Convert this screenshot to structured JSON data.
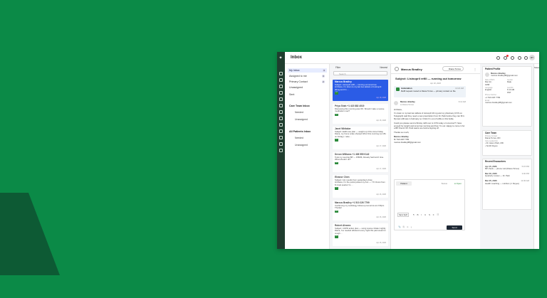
{
  "app": {
    "title": "Inbox",
    "avatar": "RT",
    "notif_count": "8"
  },
  "nav": {
    "items": [
      {
        "label": "My Inbox",
        "count": "3"
      },
      {
        "label": "Assigned to me",
        "count": "3"
      },
      {
        "label": "Primary Contact",
        "count": "2"
      },
      {
        "label": "Unassigned"
      },
      {
        "label": "Sent"
      }
    ],
    "care_team": {
      "title": "Care Team Inbox",
      "items": [
        "Needed",
        "Unassigned"
      ]
    },
    "all": {
      "title": "All Patients Inbox",
      "items": [
        "Needed",
        "Unassigned"
      ]
    }
  },
  "list": {
    "filter": "Filter",
    "sort": "Newest",
    "search_placeholder": "Search",
    "cards": [
      {
        "name": "Marcus Bradley",
        "line1": "Subject: Lisinopril refill — running out tomorrow",
        "line2": "Hi Diana, I'm down to my last two tablets of Lisinopril 20mg and I'm ...",
        "date": "Apr 18, 2026"
      },
      {
        "name": "Priya Shah",
        "phone": "+1 415 882 4019",
        "line1": "Discussing this morning was OK. Should I take a rescue medication now?",
        "line2": "",
        "date": "Apr 18, 2026"
      },
      {
        "name": "Janet Whitaker",
        "line1": "Subject: EHR note plan — weight up 3 lbs since Friday",
        "line2": "Diana, my home scale showed 184.2 this morning (vs 181 on Friday). I also ...",
        "date": "Apr 17, 2026"
      },
      {
        "name": "Devon Williams",
        "phone": "+1 408 555 0142",
        "line1": "Took my evening BP — 158/96, Already had lunch time. What should I do?",
        "line2": "",
        "date": "Apr 17, 2026"
      },
      {
        "name": "Eleanor Chen",
        "line1": "Subject: A1c results from yesterday's draw",
        "line2": "Hi Diana, I'm the portal posted my A1c — 7.8. Down from 8.1 last quarter! Is ...",
        "date": "Apr 16, 2026"
      },
      {
        "name": "Marcus Bradley",
        "phone": "+1 510 226 7799",
        "line1": "Confirming my cardiology follow-up tomorrow at 2:30pm. Thanks!",
        "line2": "",
        "date": "Apr 16, 2026"
      },
      {
        "name": "Robert Alvarez",
        "line1": "Subject: COPD action plan — using rescue inhaler nightly",
        "line2": "Diana, I've needed albuterol every night this past week for cough ...",
        "date": "Apr 15, 2026"
      }
    ]
  },
  "conv": {
    "name": "Marcus Bradley",
    "assignee": "Diana Torres",
    "subject": "Subject: Lisinopril refill — running out tomorrow",
    "date": "Apr 18, 2026",
    "auto_title": "Automation",
    "auto_time": "10:22 AM",
    "auto_text": "Refill request routed to Diana Torres — primary contact on file.",
    "msg_from": "Marcus Bradley",
    "msg_to": "to Diana Torres",
    "msg_time": "9:14 AM",
    "msg_body": [
      "Hi Diana,",
      "I'm down to my last two tablets of Lisinopril 20 mg and my pharmacy (CVS on Telegraph) said they need a new prescription from Dr. Park before they can fill it. My last refill was in February so I think I'm out of refills on this bottle.",
      "Could you please send a 90-day refill over to CVS today or tomorrow? I have enough for tonight and tomorrow morning and then I'm out. Happy to come in for a BP check if Dr. Park wants one before signing off.",
      "Thanks so much,",
      "Marcus Bradley",
      "M: 510 226 7799",
      "marcus.bradley98@gmail.com"
    ],
    "compose_tab": "Patient",
    "compose_status": "Open",
    "compose_hint": "Status",
    "send": "Send",
    "format": "Sans Serif"
  },
  "side": {
    "profile": {
      "title": "Patient Profile",
      "name": "Marcus Bradley",
      "email": "marcus.bradley98@gmail.com",
      "dob_l": "Date of Birth",
      "dob": "Mar 22, 1958",
      "gender_l": "Gender",
      "gender": "Male",
      "lang_l": "Language",
      "lang": "English",
      "last_l": "Last Fill",
      "last": "6:13 AM PDT",
      "phone_l": "Phone Number",
      "phone": "+1 510 226 7799",
      "email_l": "Email",
      "email2": "marcus.bradley98@gmail.com"
    },
    "care": {
      "title": "Care Team",
      "pc_l": "Primary Contact",
      "pc": "Diana Torres, RN",
      "lt_l": "Care Leadership",
      "lt": "• Dr. Helen Park, MD",
      "lt2": "• Smith Reyes"
    },
    "enc": {
      "title": "Recent Encounters",
      "items": [
        {
          "date": "Apr 15, 2026",
          "time": "5:15 PM",
          "text": "BP check — phone visit (Diana Torres)"
        },
        {
          "date": "Mar 30, 2026",
          "time": "3:00 PM",
          "text": "Quarterly review — Dr. Park"
        },
        {
          "date": "Mar 25, 2026",
          "time": "11:00 AM",
          "text": "Health coaching — nutrition (J. Reyes)"
        }
      ]
    }
  },
  "dock": {
    "label": "Notes"
  }
}
